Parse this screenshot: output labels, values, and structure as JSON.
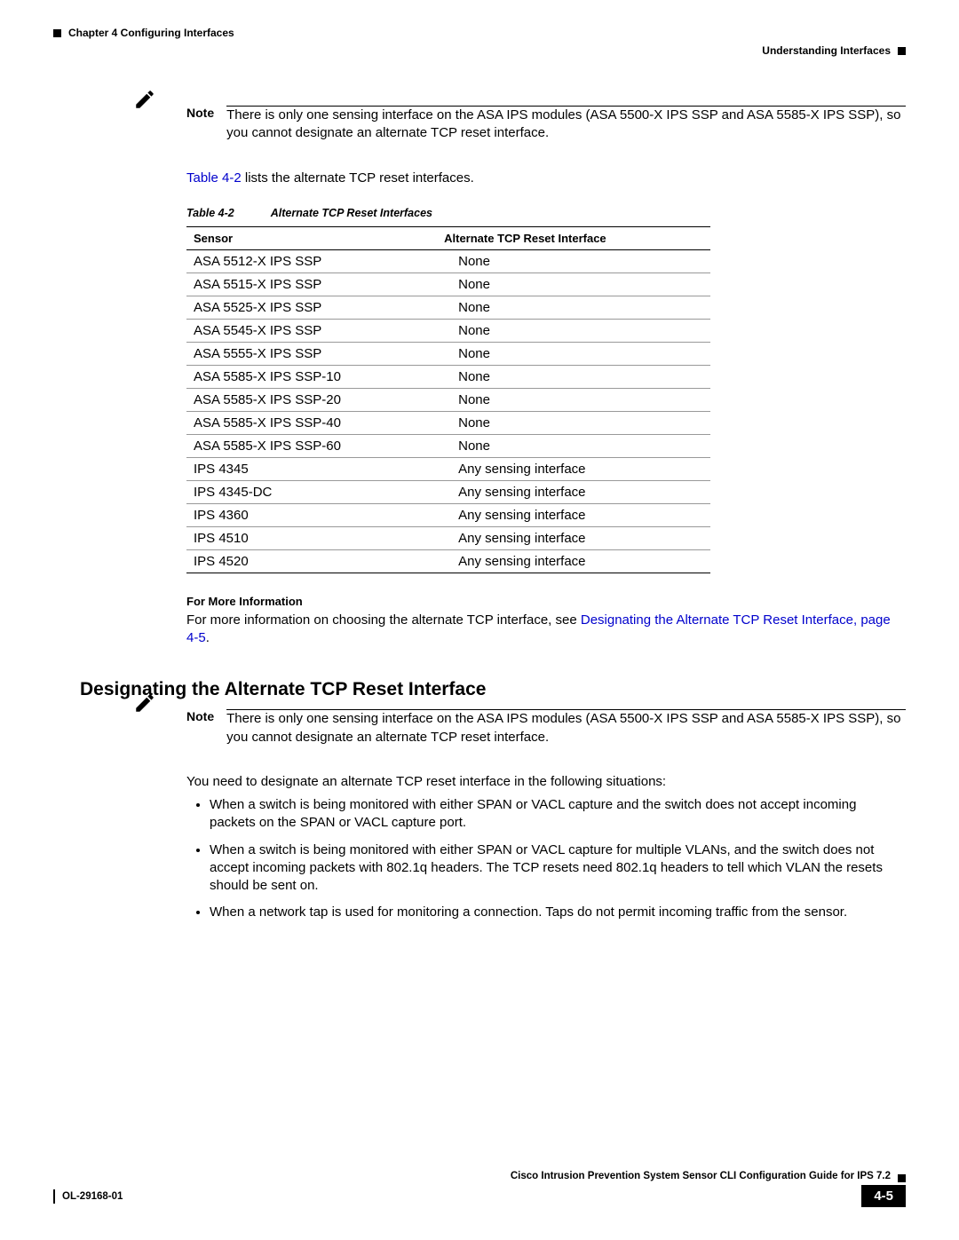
{
  "header": {
    "chapter": "Chapter 4      Configuring Interfaces",
    "section": "Understanding Interfaces"
  },
  "note1": {
    "label": "Note",
    "text": "There is only one sensing interface on the ASA IPS modules (ASA 5500-X IPS SSP and ASA 5585-X IPS SSP), so you cannot designate an alternate TCP reset interface."
  },
  "afterNote1_a": "Table 4-2",
  "afterNote1_b": " lists the alternate TCP reset interfaces.",
  "tableCaption": {
    "num": "Table 4-2",
    "title": "Alternate TCP Reset Interfaces"
  },
  "tableHeaders": {
    "c1": "Sensor",
    "c2": "Alternate TCP Reset Interface"
  },
  "rows": [
    {
      "c1": "ASA 5512-X IPS SSP",
      "c2": "None"
    },
    {
      "c1": "ASA 5515-X IPS SSP",
      "c2": "None"
    },
    {
      "c1": "ASA 5525-X IPS SSP",
      "c2": "None"
    },
    {
      "c1": "ASA 5545-X IPS SSP",
      "c2": "None"
    },
    {
      "c1": "ASA 5555-X IPS SSP",
      "c2": "None"
    },
    {
      "c1": "ASA 5585-X IPS SSP-10",
      "c2": "None"
    },
    {
      "c1": "ASA 5585-X IPS SSP-20",
      "c2": "None"
    },
    {
      "c1": "ASA 5585-X IPS SSP-40",
      "c2": "None"
    },
    {
      "c1": "ASA 5585-X IPS SSP-60",
      "c2": "None"
    },
    {
      "c1": "IPS 4345",
      "c2": "Any sensing interface"
    },
    {
      "c1": "IPS 4345-DC",
      "c2": "Any sensing interface"
    },
    {
      "c1": "IPS 4360",
      "c2": "Any sensing interface"
    },
    {
      "c1": "IPS 4510",
      "c2": "Any sensing interface"
    },
    {
      "c1": "IPS 4520",
      "c2": "Any sensing interface"
    }
  ],
  "moreInfo": {
    "heading": "For More Information",
    "pre": "For more information on choosing the alternate TCP interface, see ",
    "link": "Designating the Alternate TCP Reset Interface, page 4-5",
    "post": "."
  },
  "sectionTitle": "Designating the Alternate TCP Reset Interface",
  "note2": {
    "label": "Note",
    "text": "There is only one sensing interface on the ASA IPS modules (ASA 5500-X IPS SSP and ASA 5585-X IPS SSP), so you cannot designate an alternate TCP reset interface."
  },
  "para2": "You need to designate an alternate TCP reset interface in the following situations:",
  "bullets": [
    "When a switch is being monitored with either SPAN or VACL capture and the switch does not accept incoming packets on the SPAN or VACL capture port.",
    "When a switch is being monitored with either SPAN or VACL capture for multiple VLANs, and the switch does not accept incoming packets with 802.1q headers. The TCP resets need 802.1q headers to tell which VLAN the resets should be sent on.",
    "When a network tap is used for monitoring a connection. Taps do not permit incoming traffic from the sensor."
  ],
  "footer": {
    "guide": "Cisco Intrusion Prevention System Sensor CLI Configuration Guide for IPS 7.2",
    "doc": "OL-29168-01",
    "page": "4-5"
  }
}
